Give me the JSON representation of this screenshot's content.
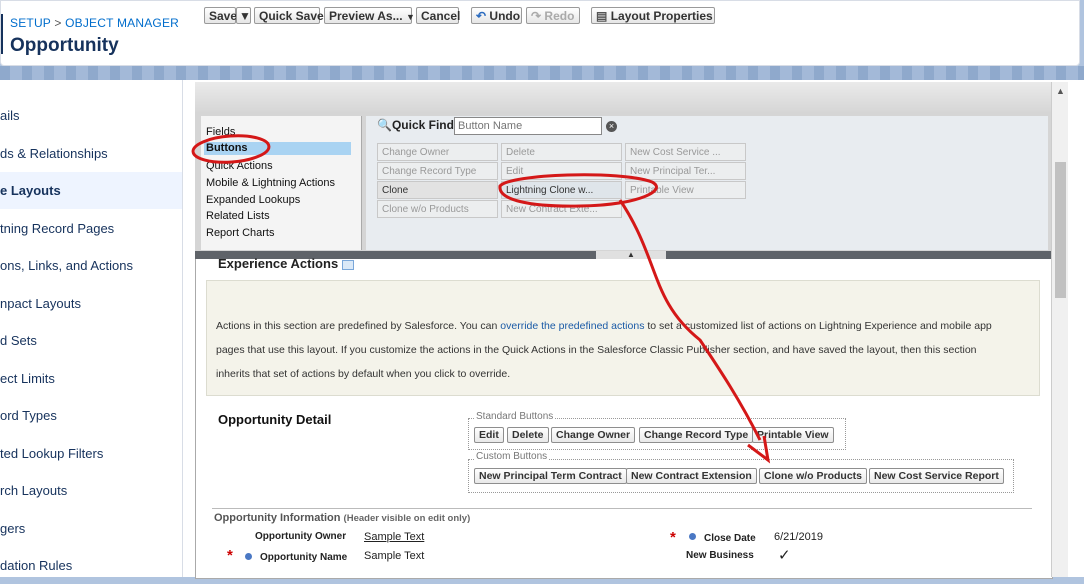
{
  "header": {
    "crumb_setup": "SETUP",
    "crumb_sep": ">",
    "crumb_object_manager": "OBJECT MANAGER",
    "title": "Opportunity"
  },
  "sidebar": {
    "items": [
      {
        "label": "ails"
      },
      {
        "label": "ds & Relationships"
      },
      {
        "label": "e Layouts"
      },
      {
        "label": "tning Record Pages"
      },
      {
        "label": "ons, Links, and Actions"
      },
      {
        "label": "npact Layouts"
      },
      {
        "label": "d Sets"
      },
      {
        "label": "ect Limits"
      },
      {
        "label": "ord Types"
      },
      {
        "label": "ted Lookup Filters"
      },
      {
        "label": "rch Layouts"
      },
      {
        "label": "gers"
      },
      {
        "label": "dation Rules"
      }
    ]
  },
  "toolbar": {
    "save": "Save",
    "quick_save": "Quick Save",
    "preview_as": "Preview As...",
    "cancel": "Cancel",
    "undo": "Undo",
    "redo": "Redo",
    "layout_properties": "Layout Properties"
  },
  "palette": {
    "categories": [
      "Fields",
      "Buttons",
      "Quick Actions",
      "Mobile & Lightning Actions",
      "Expanded Lookups",
      "Related Lists",
      "Report Charts"
    ],
    "quick_find_label": "Quick Find",
    "quick_find_placeholder": "Button Name",
    "buttons": [
      [
        "Change Owner",
        "Delete",
        "New Cost Service ..."
      ],
      [
        "Change Record Type",
        "Edit",
        "New Principal Ter..."
      ],
      [
        "Clone",
        "Lightning Clone w...",
        "Printable View"
      ],
      [
        "Clone w/o Products",
        "New Contract Exte..."
      ]
    ]
  },
  "layout": {
    "experience_actions": "Experience Actions",
    "exp_line1_pre": "Actions in this section are predefined by Salesforce. You can ",
    "exp_line1_link": "override the predefined actions",
    "exp_line1_post": " to set a customized list of actions on Lightning Experience and mobile app",
    "exp_line2": "pages that use this layout. If you customize the actions in the Quick Actions in the Salesforce Classic Publisher section, and have saved the layout, then this section",
    "exp_line3": "inherits that set of actions by default when you click to override.",
    "detail_title": "Opportunity Detail",
    "standard_buttons_label": "Standard Buttons",
    "standard_buttons": [
      "Edit",
      "Delete",
      "Change Owner",
      "Change Record Type",
      "Printable View"
    ],
    "custom_buttons_label": "Custom Buttons",
    "custom_buttons": [
      "New Principal Term Contract",
      "New Contract Extension",
      "Clone w/o Products",
      "New Cost Service Report"
    ],
    "section_title": "Opportunity Information",
    "section_note": "(Header visible on edit only)",
    "fields": {
      "opportunity_owner_label": "Opportunity Owner",
      "opportunity_owner_value": "Sample Text",
      "opportunity_name_label": "Opportunity Name",
      "opportunity_name_value": "Sample Text",
      "close_date_label": "Close Date",
      "close_date_value": "6/21/2019",
      "new_business_label": "New Business",
      "new_business_value": "✓"
    }
  },
  "colors": {
    "annotation_red": "#d41818",
    "selected_category": "#a9d3f2",
    "link": "#1a5aa6"
  }
}
